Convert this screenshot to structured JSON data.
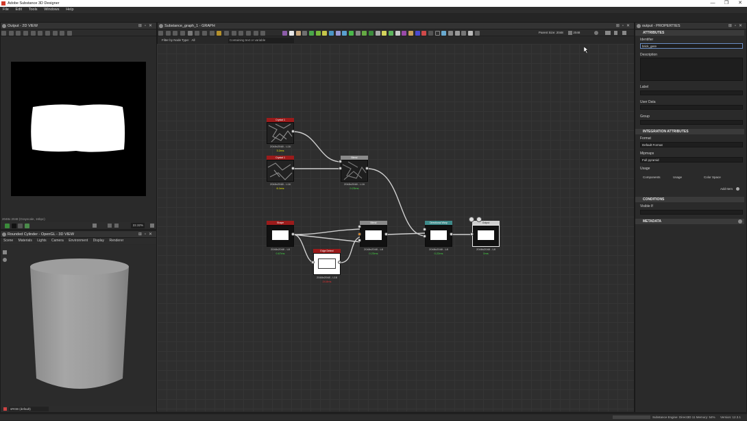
{
  "window": {
    "title": "Adobe Substance 3D Designer",
    "controls": [
      "—",
      "❐",
      "✕"
    ]
  },
  "menu": [
    "File",
    "Edit",
    "Tools",
    "Windows",
    "Help"
  ],
  "view2d": {
    "title": "Output - 2D VIEW",
    "status": "2048x 2048 (Grayscale, 16bpc)",
    "zoom": "22.32%"
  },
  "view3d": {
    "title": "Rounded Cylinder - OpenGL - 3D VIEW",
    "menu": [
      "Scene",
      "Materials",
      "Lights",
      "Camera",
      "Environment",
      "Display",
      "Renderer"
    ],
    "colorspace": "sRGB (default)"
  },
  "graph": {
    "title": "Substance_graph_1 - GRAPH",
    "filter_label": "Filter by Node Type:",
    "filter_value": "All",
    "search_placeholder": "Containing text or variable",
    "parent_size_label": "Parent Size:",
    "parent_size_value": "2048",
    "size_value": "2048",
    "nodes": [
      {
        "id": "crystal1a",
        "title": "Crystal 1",
        "info": "2048x2048 - L16",
        "time": "3.2ms",
        "time_color": "#e8e800",
        "head": "#9b1b1b"
      },
      {
        "id": "crystal1b",
        "title": "Crystal 1",
        "info": "2048x2048 - L16",
        "time": "6.1ms",
        "time_color": "#e8e800",
        "head": "#9b1b1b"
      },
      {
        "id": "blend1",
        "title": "Blend",
        "info": "2048x2048 - L16",
        "time": "0.23ms",
        "time_color": "#46d846",
        "head": "#8a8a8a"
      },
      {
        "id": "shape",
        "title": "Shape",
        "info": "2048x2048 - L8",
        "time": "0.67ms",
        "time_color": "#46d846",
        "head": "#9b1b1b"
      },
      {
        "id": "edgedetect",
        "title": "Edge Detect",
        "info": "2048x2048 - L16",
        "time": "24.8ms",
        "time_color": "#e83030",
        "head": "#9b1b1b"
      },
      {
        "id": "blend2",
        "title": "Blend",
        "info": "2048x2048 - L8",
        "time": "0.23ms",
        "time_color": "#46d846",
        "head": "#8a8a8a"
      },
      {
        "id": "dirwarp",
        "title": "Directional Warp",
        "info": "2048x2048 - L8",
        "time": "0.22ms",
        "time_color": "#46d846",
        "head": "#3e8a8a"
      },
      {
        "id": "output",
        "title": "Output",
        "info": "2048x2048 - L8",
        "time": "0ms",
        "time_color": "#46d846",
        "head": "#cfcfcf"
      }
    ]
  },
  "properties": {
    "title": "output - PROPERTIES",
    "sections": {
      "attributes": "ATTRIBUTES",
      "integration": "INTEGRATION ATTRIBUTES",
      "conditions": "CONDITIONS",
      "metadata": "METADATA"
    },
    "identifier_label": "Identifier",
    "identifier_value": "brick_gere",
    "description_label": "Description",
    "label_label": "Label",
    "userdata_label": "User Data",
    "group_label": "Group",
    "format_label": "Format",
    "format_value": "Default Format",
    "mipmaps_label": "Mipmaps",
    "mipmaps_value": "Full pyramid",
    "usage_label": "Usage",
    "usage_cols": [
      "Components",
      "Usage",
      "Color Space"
    ],
    "add_item": "Add Item",
    "visible_if_label": "Visible If"
  },
  "status": {
    "engine": "Substance Engine: Direct3D 11  Memory: 54%",
    "version": "Version: 12.3.1"
  }
}
